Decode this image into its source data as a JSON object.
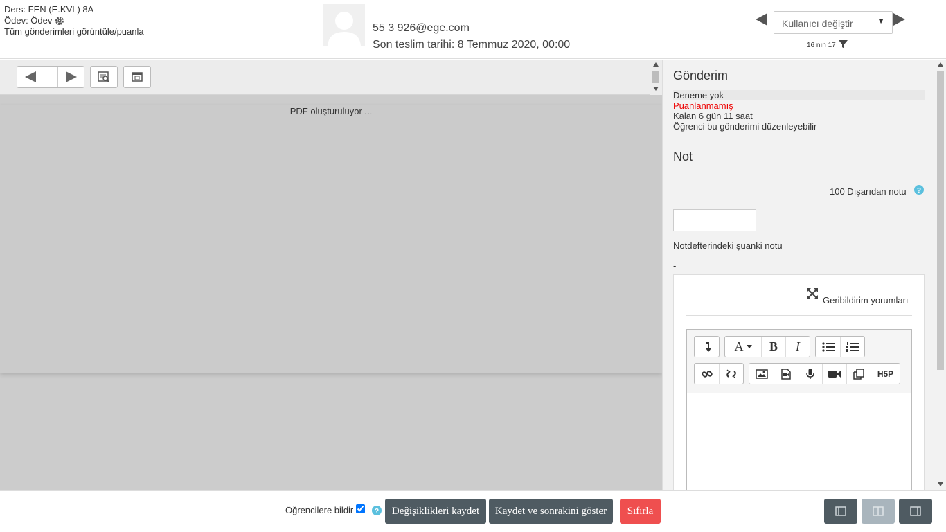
{
  "header": {
    "course": "Ders: FEN (E.KVL) 8A",
    "assignment": "Ödev: Ödev",
    "view_all": "Tüm gönderimleri görüntüle/puanla",
    "user_name": "—",
    "user_id_email": "55       3  926@ege.com",
    "due_date": "Son teslim tarihi: 8 Temmuz 2020, 00:00",
    "user_select_placeholder": "Kullanıcı değiştir",
    "user_count": "16 nın 17"
  },
  "pdf": {
    "loading_text": "PDF oluşturuluyor ..."
  },
  "submission": {
    "heading": "Gönderim",
    "attempt": "Deneme yok",
    "grade_status": "Puanlanmamış",
    "time_left": "Kalan 6 gün 11 saat",
    "editable": "Öğrenci bu gönderimi düzenleyebilir"
  },
  "grade": {
    "heading": "Not",
    "label": "100 Dışarıdan notu",
    "value": "",
    "current_label": "Notdefterindeki şuanki notu",
    "current_value": "-"
  },
  "feedback": {
    "label": "Geribildirim yorumları",
    "bold": "B",
    "italic": "I",
    "font": "A",
    "h5p": "H5P"
  },
  "footer": {
    "notify_label": "Öğrencilere bildir",
    "notify_checked": true,
    "save": "Değişiklikleri kaydet",
    "save_next": "Kaydet ve sonrakini göster",
    "reset": "Sıfırla"
  },
  "colors": {
    "primary_button": "#4f5b62",
    "reset_button": "#ef4f4f",
    "ungraded": "#ee0000",
    "help_icon": "#5bc0de"
  }
}
